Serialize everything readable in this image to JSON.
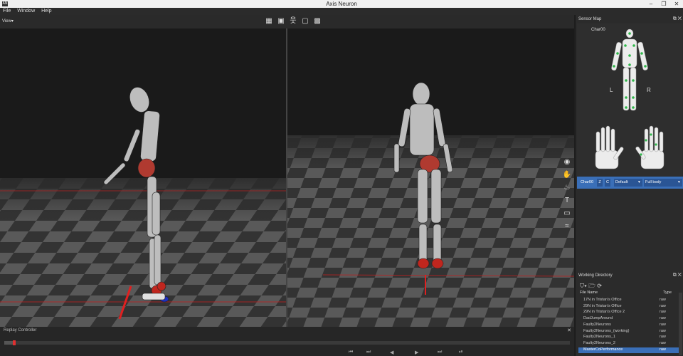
{
  "window": {
    "title": "Axis Neuron",
    "app_icon_label": "AN",
    "minimize": "–",
    "maximize": "❐",
    "close": "✕"
  },
  "menu": [
    "File",
    "Window",
    "Help"
  ],
  "viewport": {
    "view_menu_label": "View▾",
    "toolbar_icons": [
      "grid-icon",
      "camera-icon",
      "figure-icon",
      "square-icon",
      "pattern-icon"
    ],
    "side_tools": [
      "record-icon",
      "hand-icon",
      "foot-icon",
      "t-pose-icon",
      "calibrate-icon",
      "wave-icon"
    ]
  },
  "replay_controller": {
    "title": "Replay Controller",
    "close": "✕",
    "progress_fraction": 0.02,
    "transport": [
      "⏮",
      "⏭",
      "◀",
      "▶",
      "⏭",
      "⏯"
    ]
  },
  "sensor_map": {
    "title": "Sensor Map",
    "character_name": "Char00",
    "left_label": "L",
    "right_label": "R",
    "sensor_color": "#2fb84a"
  },
  "char_bar": {
    "character": "Char00",
    "z_button": "Z",
    "c_button": "C",
    "profile": "Default",
    "body_mode": "Full body"
  },
  "working_directory": {
    "title": "Working Directory",
    "col_filename": "File Name",
    "col_type": "Type",
    "files": [
      {
        "name": "17N in Tristan's Office",
        "type": "raw"
      },
      {
        "name": "29N in Tristan's Office",
        "type": "raw"
      },
      {
        "name": "29N in Tristan's Office 2",
        "type": "raw"
      },
      {
        "name": "DadJumpAround",
        "type": "raw"
      },
      {
        "name": "Faulty2Neurons",
        "type": "raw"
      },
      {
        "name": "Faulty2Neurons_(working)",
        "type": "raw"
      },
      {
        "name": "Faulty2Neurons_1",
        "type": "raw"
      },
      {
        "name": "Faulty2Neurons_2",
        "type": "raw"
      },
      {
        "name": "MasterCoPerformance",
        "type": "raw",
        "selected": true
      }
    ]
  },
  "colors": {
    "accent": "#3a6fb8",
    "marker_red": "#e03030",
    "floor_dark": "#2f2f2f",
    "floor_light": "#5a5a5a"
  }
}
